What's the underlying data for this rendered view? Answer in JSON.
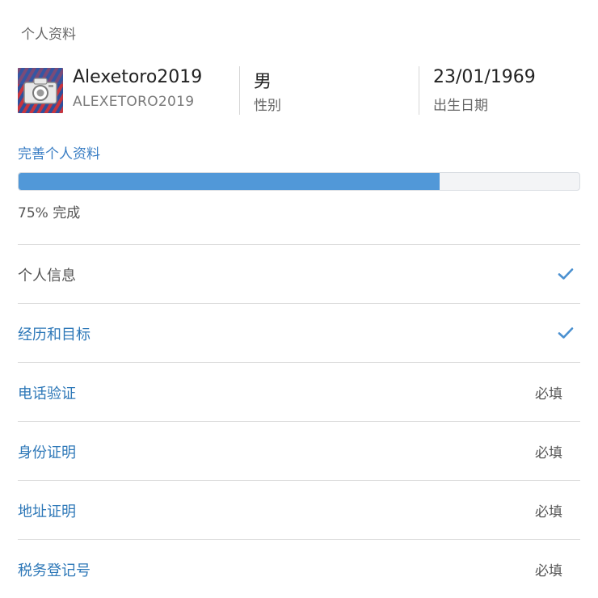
{
  "section_title": "个人资料",
  "profile": {
    "display_name": "Alexetoro2019",
    "username": "ALEXETORO2019",
    "avatar_icon": "camera-icon",
    "gender_value": "男",
    "gender_label": "性别",
    "dob_value": "23/01/1969",
    "dob_label": "出生日期"
  },
  "completion": {
    "link_label": "完善个人资料",
    "percent": 75,
    "progress_text": "75% 完成",
    "fill_color": "#5198d8"
  },
  "checklist": [
    {
      "label": "个人信息",
      "status": "",
      "done": true
    },
    {
      "label": "经历和目标",
      "status": "",
      "done": true
    },
    {
      "label": "电话验证",
      "status": "必填",
      "done": false
    },
    {
      "label": "身份证明",
      "status": "必填",
      "done": false
    },
    {
      "label": "地址证明",
      "status": "必填",
      "done": false
    },
    {
      "label": "税务登记号",
      "status": "必填",
      "done": false
    }
  ],
  "colors": {
    "link": "#2e78b8",
    "check": "#4a90d0"
  }
}
